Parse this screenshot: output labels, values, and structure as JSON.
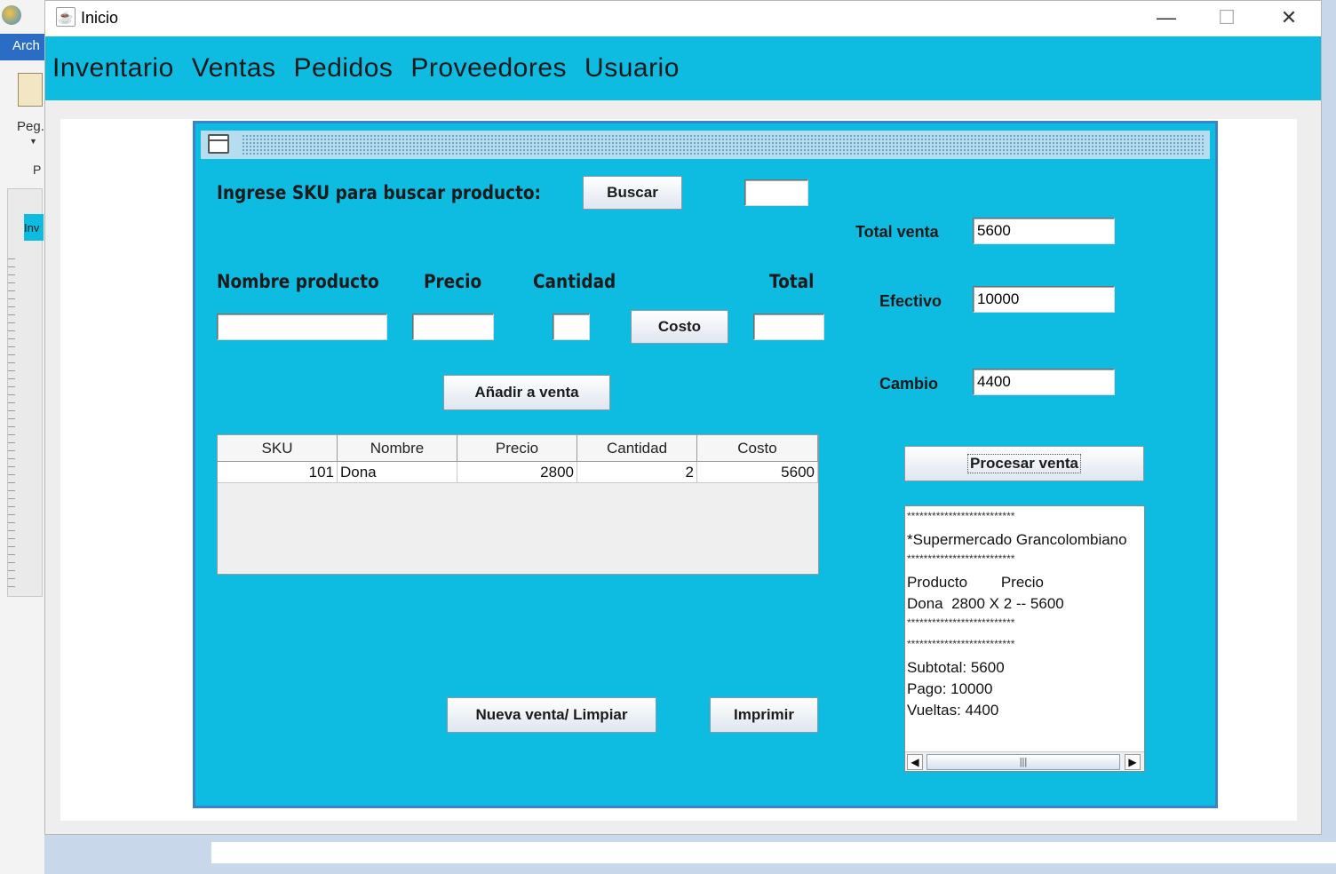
{
  "background_app": {
    "ribbon_label": "Arch",
    "paste_label": "Peg.",
    "clip_label": "P",
    "doc_tab_label": "Inv"
  },
  "window": {
    "title": "Inicio",
    "minimize_glyph": "—",
    "maximize_glyph": "☐",
    "close_glyph": "✕"
  },
  "menu": {
    "items": [
      "Inventario",
      "Ventas",
      "Pedidos",
      "Proveedores",
      "Usuario"
    ]
  },
  "form": {
    "sku_label": "Ingrese SKU para buscar producto:",
    "search_button": "Buscar",
    "sku_value": "",
    "product_name_label": "Nombre producto",
    "price_label": "Precio",
    "quantity_label": "Cantidad",
    "total_label": "Total",
    "product_name_value": "",
    "price_value": "",
    "quantity_value": "",
    "cost_button": "Costo",
    "total_value": "",
    "add_button": "Añadir a venta",
    "total_sale_label": "Total venta",
    "total_sale_value": "5600",
    "cash_label": "Efectivo",
    "cash_value": "10000",
    "change_label": "Cambio",
    "change_value": "4400",
    "process_button": "Procesar venta",
    "new_sale_button": "Nueva venta/ Limpiar",
    "print_button": "Imprimir"
  },
  "table": {
    "columns": [
      "SKU",
      "Nombre",
      "Precio",
      "Cantidad",
      "Costo"
    ],
    "rows": [
      [
        "101",
        "Dona",
        "2800",
        "2",
        "5600"
      ]
    ]
  },
  "receipt": {
    "lines": [
      "**************************",
      "*Supermercado Grancolombiano",
      "**************************",
      "Producto        Precio",
      "Dona  2800 X 2 -- 5600",
      "**************************",
      "**************************",
      "Subtotal: 5600",
      "Pago: 10000",
      "Vueltas: 4400"
    ]
  },
  "colors": {
    "panel": "#0ebbe1",
    "frame_border": "#3c84c8"
  }
}
